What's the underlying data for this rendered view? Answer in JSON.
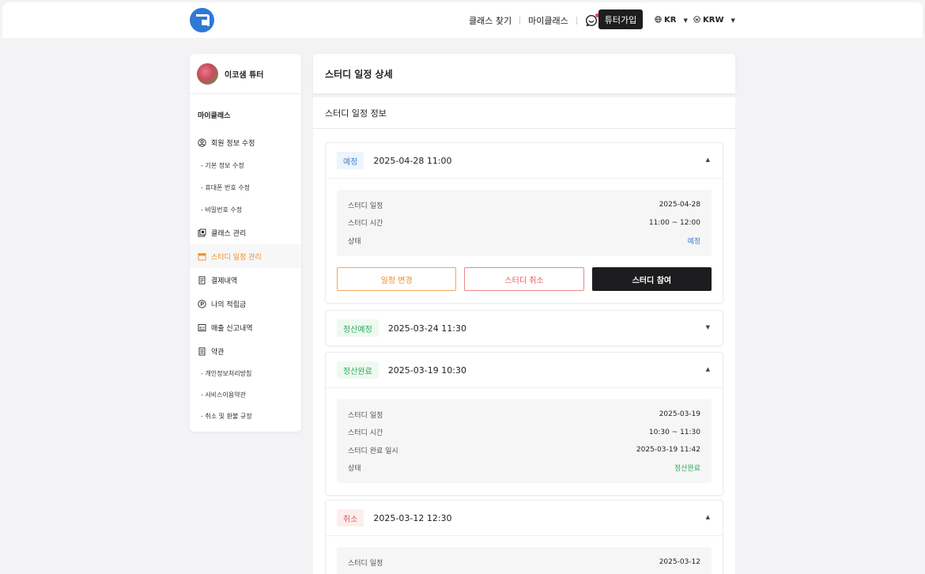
{
  "header": {
    "nav_find_class": "클래스 찾기",
    "nav_my_class": "마이클래스",
    "join_button": "튜터가입",
    "language": "KR",
    "currency": "KRW"
  },
  "sidebar": {
    "profile_name": "이코샘 튜터",
    "section_title": "마이클래스",
    "items": [
      {
        "label": "회원 정보 수정",
        "icon": "user-circle-icon"
      },
      {
        "label": "- 기본 정보 수정"
      },
      {
        "label": "- 휴대폰 번호 수정"
      },
      {
        "label": "- 비밀번호 수정"
      },
      {
        "label": "클래스 관리",
        "icon": "class-manage-icon"
      },
      {
        "label": "스터디 일정 관리",
        "icon": "calendar-icon"
      },
      {
        "label": "결제내역",
        "icon": "receipt-icon"
      },
      {
        "label": "나의 적립금",
        "icon": "points-icon"
      },
      {
        "label": "매출 신고내역",
        "icon": "sales-report-icon"
      },
      {
        "label": "약관",
        "icon": "document-icon"
      },
      {
        "label": "- 개인정보처리방침"
      },
      {
        "label": "- 서비스이용약관"
      },
      {
        "label": "- 취소 및 환불 규정"
      }
    ]
  },
  "main": {
    "page_title": "스터디 일정 상세",
    "section_title": "스터디 일정 정보",
    "cards": [
      {
        "badge": "예정",
        "datetime": "2025-04-28 11:00",
        "rows": [
          {
            "label": "스터디 일정",
            "value": "2025-04-28"
          },
          {
            "label": "스터디 시간",
            "value": "11:00 ~ 12:00"
          },
          {
            "label": "상태",
            "value": "예정"
          }
        ],
        "actions": {
          "change": "일정 변경",
          "cancel": "스터디 취소",
          "join": "스터디 참여"
        }
      },
      {
        "badge": "정산예정",
        "datetime": "2025-03-24 11:30"
      },
      {
        "badge": "정산완료",
        "datetime": "2025-03-19 10:30",
        "rows": [
          {
            "label": "스터디 일정",
            "value": "2025-03-19"
          },
          {
            "label": "스터디 시간",
            "value": "10:30 ~ 11:30"
          },
          {
            "label": "스터디 완료 일시",
            "value": "2025-03-19 11:42"
          },
          {
            "label": "상태",
            "value": "정산완료"
          }
        ]
      },
      {
        "badge": "취소",
        "datetime": "2025-03-12 12:30",
        "rows": [
          {
            "label": "스터디 일정",
            "value": "2025-03-12"
          }
        ]
      }
    ]
  },
  "colors": {
    "accent_orange": "#f08b24",
    "status_blue": "#3b82d6",
    "status_green": "#2fa95a",
    "status_red": "#e45757",
    "dark": "#1d1d1f"
  }
}
